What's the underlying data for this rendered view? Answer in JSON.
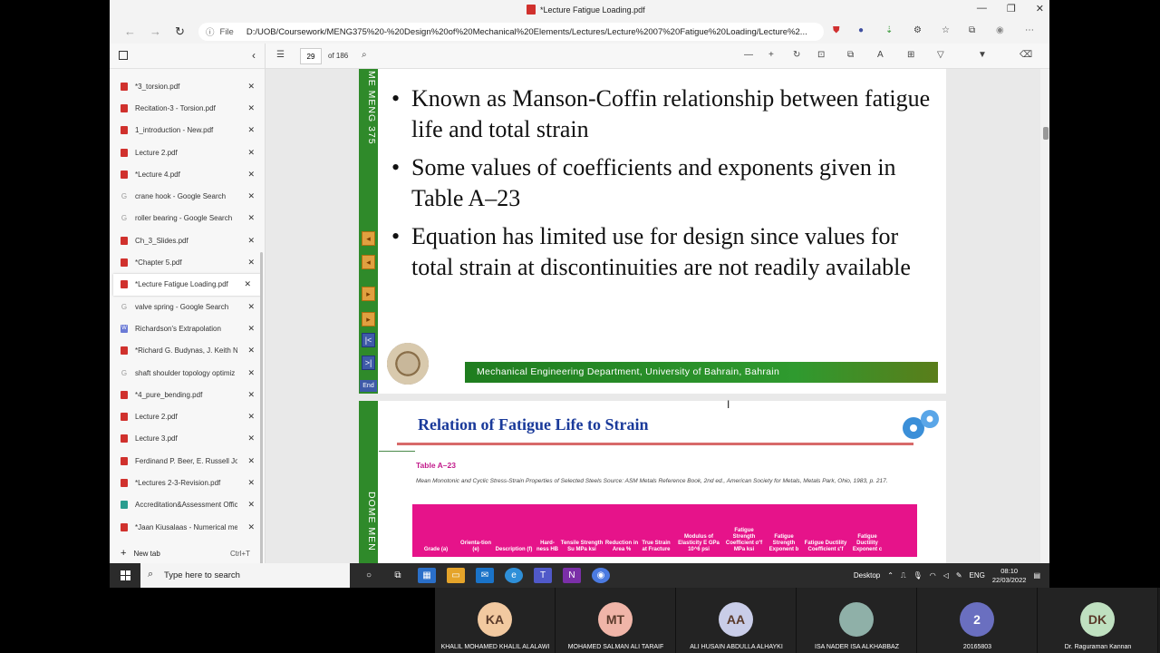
{
  "browser": {
    "window_title": "*Lecture Fatigue Loading.pdf",
    "address_prefix": "File",
    "url": "D:/UOB/Coursework/MENG375%20-%20Design%20of%20Mechanical%20Elements/Lectures/Lecture%2007%20Fatigue%20Loading/Lecture%2..."
  },
  "sidebar": {
    "tabs": [
      {
        "label": "*3_torsion.pdf",
        "icon": "pdf-icon",
        "type": "pdf"
      },
      {
        "label": "Recitation-3 - Torsion.pdf",
        "icon": "pdf-icon",
        "type": "pdf"
      },
      {
        "label": "1_introduction - New.pdf",
        "icon": "pdf-icon",
        "type": "pdf"
      },
      {
        "label": "Lecture 2.pdf",
        "icon": "pdf-icon",
        "type": "pdf"
      },
      {
        "label": "*Lecture 4.pdf",
        "icon": "pdf-icon",
        "type": "pdf"
      },
      {
        "label": "crane hook - Google Search",
        "icon": "google-icon",
        "type": "g"
      },
      {
        "label": "roller bearing - Google Search",
        "icon": "google-icon",
        "type": "g"
      },
      {
        "label": "Ch_3_Slides.pdf",
        "icon": "pdf-icon",
        "type": "pdf"
      },
      {
        "label": "*Chapter 5.pdf",
        "icon": "pdf-icon",
        "type": "pdf"
      },
      {
        "label": "*Lecture Fatigue Loading.pdf",
        "icon": "pdf-icon",
        "type": "pdf",
        "active": true
      },
      {
        "label": "valve spring - Google Search",
        "icon": "google-icon",
        "type": "g"
      },
      {
        "label": "Richardson's Extrapolation",
        "icon": "word-icon",
        "type": "w"
      },
      {
        "label": "*Richard G. Budynas, J. Keith Nis",
        "icon": "pdf-icon",
        "type": "pdf"
      },
      {
        "label": "shaft shoulder topology optimiz",
        "icon": "google-icon",
        "type": "g"
      },
      {
        "label": "*4_pure_bending.pdf",
        "icon": "pdf-icon",
        "type": "pdf"
      },
      {
        "label": "Lecture 2.pdf",
        "icon": "pdf-icon",
        "type": "pdf"
      },
      {
        "label": "Lecture 3.pdf",
        "icon": "pdf-icon",
        "type": "pdf"
      },
      {
        "label": "Ferdinand P. Beer, E. Russell Joh",
        "icon": "pdf-icon",
        "type": "pdf"
      },
      {
        "label": "*Lectures 2-3-Revision.pdf",
        "icon": "pdf-icon",
        "type": "pdf"
      },
      {
        "label": "Accreditation&Assessment Offic",
        "icon": "web-icon",
        "type": "acc"
      },
      {
        "label": "*Jaan Kiusalaas - Numerical met",
        "icon": "pdf-icon",
        "type": "pdf"
      }
    ],
    "new_tab_label": "New tab",
    "new_tab_shortcut": "Ctrl+T"
  },
  "pdf_toolbar": {
    "page": "29",
    "of_pages": "of 186"
  },
  "slide1": {
    "side_text": "ME MENG 375",
    "bullets": [
      "Known as Manson-Coffin relationship between fatigue life and total strain",
      "Some values of coefficients and exponents given in Table A–23",
      "Equation has limited use for design since values for total strain at discontinuities are not readily available"
    ],
    "footer": "Mechanical Engineering Department, University of Bahrain, Bahrain",
    "end_label": "End"
  },
  "slide2": {
    "title": "Relation of Fatigue Life to Strain",
    "side_text": "DOME MEN",
    "table_label": "Table A–23",
    "table_caption": "Mean Monotonic and Cyclic Stress-Strain Properties of Selected Steels   Source: ASM Metals Reference Book, 2nd ed., American Society for Metals, Metals Park, Ohio, 1983, p. 217.",
    "headers": [
      "Grade (a)",
      "Orienta-tion (e)",
      "Description (f)",
      "Hard-ness HB",
      "Tensile Strength Su MPa ksi",
      "Reduction in Area %",
      "True Strain at Fracture",
      "Modulus of Elasticity E GPa 10^6 psi",
      "Fatigue Strength Coefficient σ'f MPa ksi",
      "Fatigue Strength Exponent b",
      "Fatigue Ductility Coefficient ε'f",
      "Fatigue Ductility Exponent c"
    ]
  },
  "taskbar": {
    "search_placeholder": "Type here to search",
    "desktop_label": "Desktop",
    "language": "ENG",
    "time": "08:10",
    "date": "22/03/2022"
  },
  "meeting": {
    "participants": [
      {
        "initials": "KA",
        "name": "KHALIL MOHAMED KHALIL ALALAWI",
        "color": "#f2c9a0"
      },
      {
        "initials": "MT",
        "name": "MOHAMED SALMAN ALI TARAIF",
        "color": "#f0b5a8"
      },
      {
        "initials": "AA",
        "name": "ALI HUSAIN ABDULLA ALHAYKI",
        "color": "#c9cde8"
      },
      {
        "initials": "",
        "name": "ISA NADER ISA ALKHABBAZ",
        "color": "#8fb0a8"
      },
      {
        "initials": "2",
        "name": "20165803",
        "color": "#6a6fc0"
      },
      {
        "initials": "DK",
        "name": "Dr. Raguraman Kannan",
        "color": "#bfe0c0"
      }
    ]
  }
}
